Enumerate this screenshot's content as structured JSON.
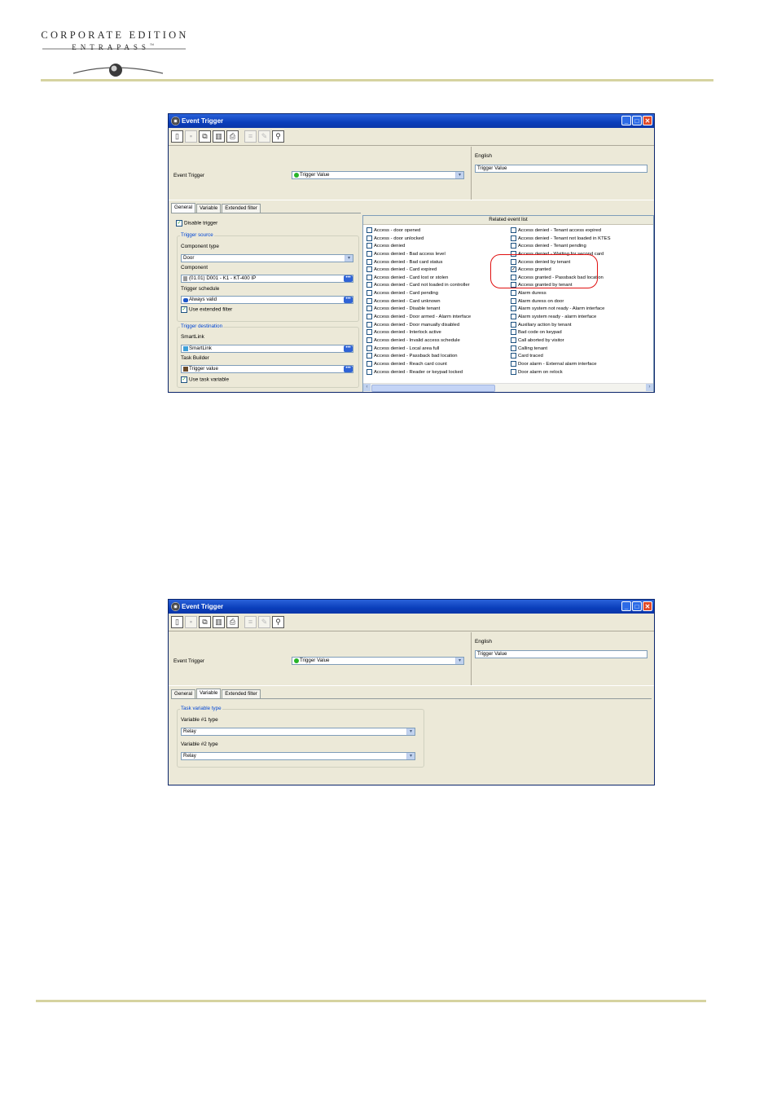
{
  "header": {
    "logo_line1": "CORPORATE EDITION",
    "logo_line2": "ENTRAPASS",
    "logo_trademark": "™",
    "rule_color": "#d6d3a0"
  },
  "window1": {
    "title": "Event Trigger",
    "title_icon": "gear-icon",
    "toolbar": [
      "new-icon",
      "save-icon",
      "copy-icon",
      "delete-icon",
      "print-icon",
      "list-icon",
      "edit-icon",
      "find-icon"
    ],
    "event_trigger_label": "Event Trigger",
    "event_trigger_value": "Trigger Value",
    "language_label": "English",
    "language_value": "Trigger Value",
    "tabs": [
      "General",
      "Variable",
      "Extended filter"
    ],
    "active_tab": "General",
    "general": {
      "disable_trigger": "Disable trigger",
      "disable_trigger_checked": true,
      "trigger_source_title": "Trigger source",
      "component_type_label": "Component type",
      "component_type_value": "Door",
      "component_label": "Component",
      "component_value": "(01.01) D001 - K1 - KT-400 IP",
      "trigger_schedule_label": "Trigger schedule",
      "trigger_schedule_value": "Always valid",
      "use_extended_filter": "Use extended filter",
      "use_extended_filter_checked": true,
      "trigger_destination_title": "Trigger destination",
      "smartlink_label": "SmartLink",
      "smartlink_value": "SmartLink",
      "task_builder_label": "Task Builder",
      "task_builder_value": "Trigger value",
      "use_task_variable": "Use task variable",
      "use_task_variable_checked": true
    },
    "related_event_list": {
      "title": "Related event list",
      "col1": [
        "Access - door opened",
        "Access - door unlocked",
        "Access denied",
        "Access denied - Bad access level",
        "Access denied - Bad card status",
        "Access denied - Card expired",
        "Access denied - Card lost or stolen",
        "Access denied - Card not loaded in controller",
        "Access denied - Card pending",
        "Access denied - Card unknown",
        "Access denied - Disable tenant",
        "Access denied - Door armed - Alarm interface",
        "Access denied - Door manually disabled",
        "Access denied - Interlock active",
        "Access denied - Invalid access schedule",
        "Access denied - Local area full",
        "Access denied - Passback bad location",
        "Access denied - Reach card count",
        "Access denied - Reader or keypad locked"
      ],
      "col2": [
        "Access denied - Tenant access expired",
        "Access denied - Tenant not loaded in KTES",
        "Access denied - Tenant pending",
        "Access denied - Waiting for second card",
        "Access denied by tenant",
        "Access granted",
        "Access granted - Passback bad location",
        "Access granted by tenant",
        "Alarm duress",
        "Alarm duress on door",
        "Alarm system not ready - Alarm interface",
        "Alarm system ready - alarm interface",
        "Auxiliary action by tenant",
        "Bad code on keypad",
        "Call aborted by visitor",
        "Calling tenant",
        "Card traced",
        "Door alarm - External alarm interface",
        "Door alarm on relock"
      ],
      "checked": "Access granted",
      "highlight_color": "#e01010"
    }
  },
  "window2": {
    "title": "Event Trigger",
    "event_trigger_label": "Event Trigger",
    "event_trigger_value": "Trigger Value",
    "language_label": "English",
    "language_value": "Trigger Value",
    "tabs": [
      "General",
      "Variable",
      "Extended filter"
    ],
    "active_tab": "Variable",
    "variable": {
      "group_title": "Task variable type",
      "var1_label": "Variable #1 type",
      "var1_value": "Relay",
      "var2_label": "Variable #2 type",
      "var2_value": "Relay"
    }
  }
}
